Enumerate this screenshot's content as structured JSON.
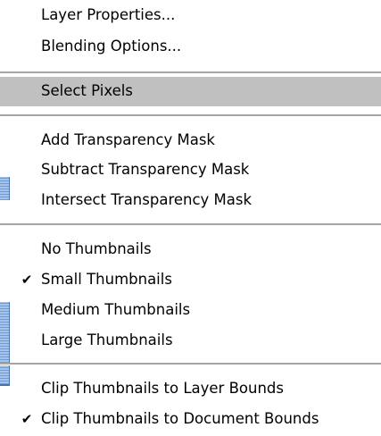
{
  "menu": {
    "groups": [
      {
        "items": [
          {
            "label": "Layer Properties...",
            "checked": false
          },
          {
            "label": "Blending Options...",
            "checked": false
          }
        ]
      },
      {
        "items": [
          {
            "label": "Select Pixels",
            "checked": false,
            "highlighted": true
          }
        ]
      },
      {
        "items": [
          {
            "label": "Add Transparency Mask",
            "checked": false
          },
          {
            "label": "Subtract Transparency Mask",
            "checked": false
          },
          {
            "label": "Intersect Transparency Mask",
            "checked": false
          }
        ]
      },
      {
        "items": [
          {
            "label": "No Thumbnails",
            "checked": false
          },
          {
            "label": "Small Thumbnails",
            "checked": true
          },
          {
            "label": "Medium Thumbnails",
            "checked": false
          },
          {
            "label": "Large Thumbnails",
            "checked": false
          }
        ]
      },
      {
        "items": [
          {
            "label": "Clip Thumbnails to Layer Bounds",
            "checked": false
          },
          {
            "label": "Clip Thumbnails to Document Bounds",
            "checked": true
          }
        ]
      }
    ],
    "check_glyph": "✔",
    "colors": {
      "highlight": "#c0c0c0",
      "separator": "#a6a6a6",
      "text": "#000000",
      "background_panel_edge": "#6f9bd3"
    }
  }
}
